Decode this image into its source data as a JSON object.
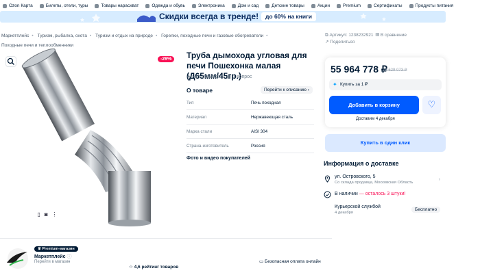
{
  "topnav": [
    "Ozon Карта",
    "Билеты, отели, туры",
    "Товары нарасхват",
    "Одежда и обувь",
    "Электроника",
    "Дом и сад",
    "Детские товары",
    "Акции",
    "Premium",
    "Сертификаты",
    "Продукты питания"
  ],
  "banner": {
    "text": "Скидки всегда в тренде!",
    "pill": "до 60% на книги"
  },
  "breadcrumbs": [
    "Маркетплейс",
    "Туризм, рыбалка, охота",
    "Туризм и отдых на природе",
    "Горелки, походные печи и газовые обогреватели",
    "Походные печи и теплообменники"
  ],
  "product": {
    "discount": "-29%",
    "title": "Труба дымохода угловая для печи Пошехонка малая (Д65мм/45гр.)",
    "reviews": "Нет отзывов",
    "questions": "1 вопрос",
    "about_title": "О товаре",
    "about_link": "Перейти к описанию",
    "specs": [
      {
        "k": "Тип",
        "v": "Печь походная"
      },
      {
        "k": "Материал",
        "v": "Нержавеющая сталь"
      },
      {
        "k": "Марка стали",
        "v": "AISI 304"
      },
      {
        "k": "Страна-изготовитель",
        "v": "Россия"
      }
    ],
    "photos_label": "Фото и видео покупателей"
  },
  "right": {
    "article": "Артикул: 1238232921",
    "compare": "В сравнение",
    "share": "Поделиться",
    "price": "55 964 778 ₽",
    "old_price": "79 629 073 ₽",
    "buy_one": "Купить за 1 ₽",
    "cart": "Добавить в корзину",
    "delivery_small": "Доставим 4 декабря",
    "one_click": "Купить в один клик",
    "delivery_title": "Информация о доставке",
    "address": "ул. Островского, 5",
    "address_sub": "Со склада продавца, Московская Область",
    "stock_prefix": "В наличии",
    "stock_warn": "— осталось 3 штуки!",
    "courier": "Курьерской службой",
    "courier_date": "4 декабря",
    "free": "Бесплатно"
  },
  "seller": {
    "badge": "Premium-магазин",
    "name": "Маркетплейс",
    "link": "Перейти в магазин",
    "rating": "4,6 рейтинг товаров",
    "safe": "Безопасная оплата онлайн"
  }
}
